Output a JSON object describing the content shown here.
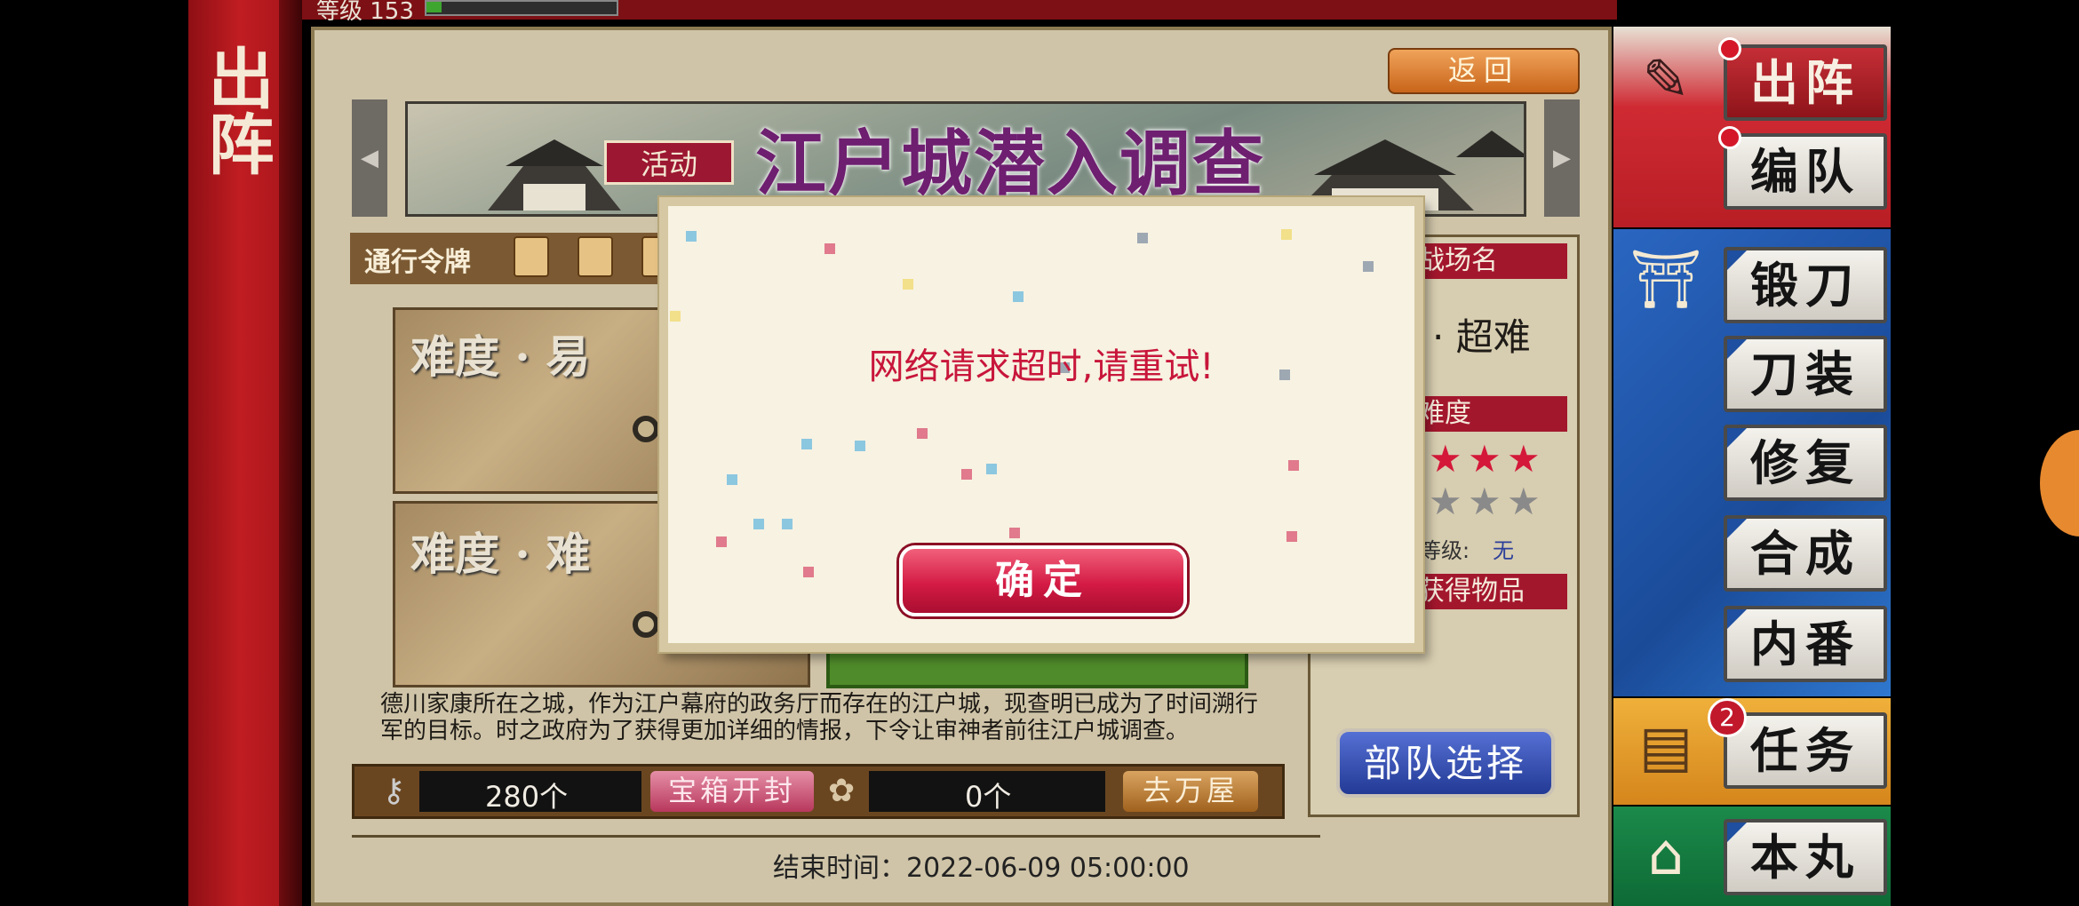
{
  "player": {
    "level_label": "等级 153",
    "exp_progress": 0.08
  },
  "left_banner": {
    "title": "出阵"
  },
  "main": {
    "back_label": "返回",
    "event_tag": "活动",
    "event_title": "江户城潜入调查",
    "token_label": "通行令牌",
    "difficulties": [
      {
        "label": "难度 · 易"
      },
      {
        "label": "难度 · 难"
      }
    ],
    "description": "德川家康所在之城，作为江户幕府的政务厅而存在的江户城，现查明已成为了时间溯行军的目标。时之政府为了获得更加详细的情报，下令让审神者前往江户城调查。",
    "resources": {
      "keys_count": "280个",
      "open_chest_label": "宝箱开封",
      "items_count": "0个",
      "go_shop_label": "去万屋"
    },
    "end_time_label": "结束时间：",
    "end_time_value": "2022-06-09 05:00:00"
  },
  "info_panel": {
    "battlefield_header": "战场名",
    "battlefield_value": "· 超难",
    "difficulty_header": "难度",
    "difficulty_stars_filled": 3,
    "level_req_label": "等级:",
    "level_req_value": "无",
    "rewards_header": "获得物品",
    "select_team_label": "部队选择"
  },
  "side_menu": {
    "items": [
      {
        "label": "出阵",
        "icon": "brush-icon"
      },
      {
        "label": "编队"
      },
      {
        "label": "锻刀",
        "icon": "forge-icon"
      },
      {
        "label": "刀装"
      },
      {
        "label": "修复"
      },
      {
        "label": "合成"
      },
      {
        "label": "内番"
      },
      {
        "label": "任务",
        "icon": "scroll-icon",
        "badge": "2"
      },
      {
        "label": "本丸",
        "icon": "castle-icon"
      }
    ]
  },
  "dialog": {
    "message": "网络请求超时,请重试!",
    "confirm_label": "确定"
  },
  "colors": {
    "accent_red": "#c8163a",
    "menu_blue": "#1e4fa0",
    "banner_red": "#c01d22"
  }
}
